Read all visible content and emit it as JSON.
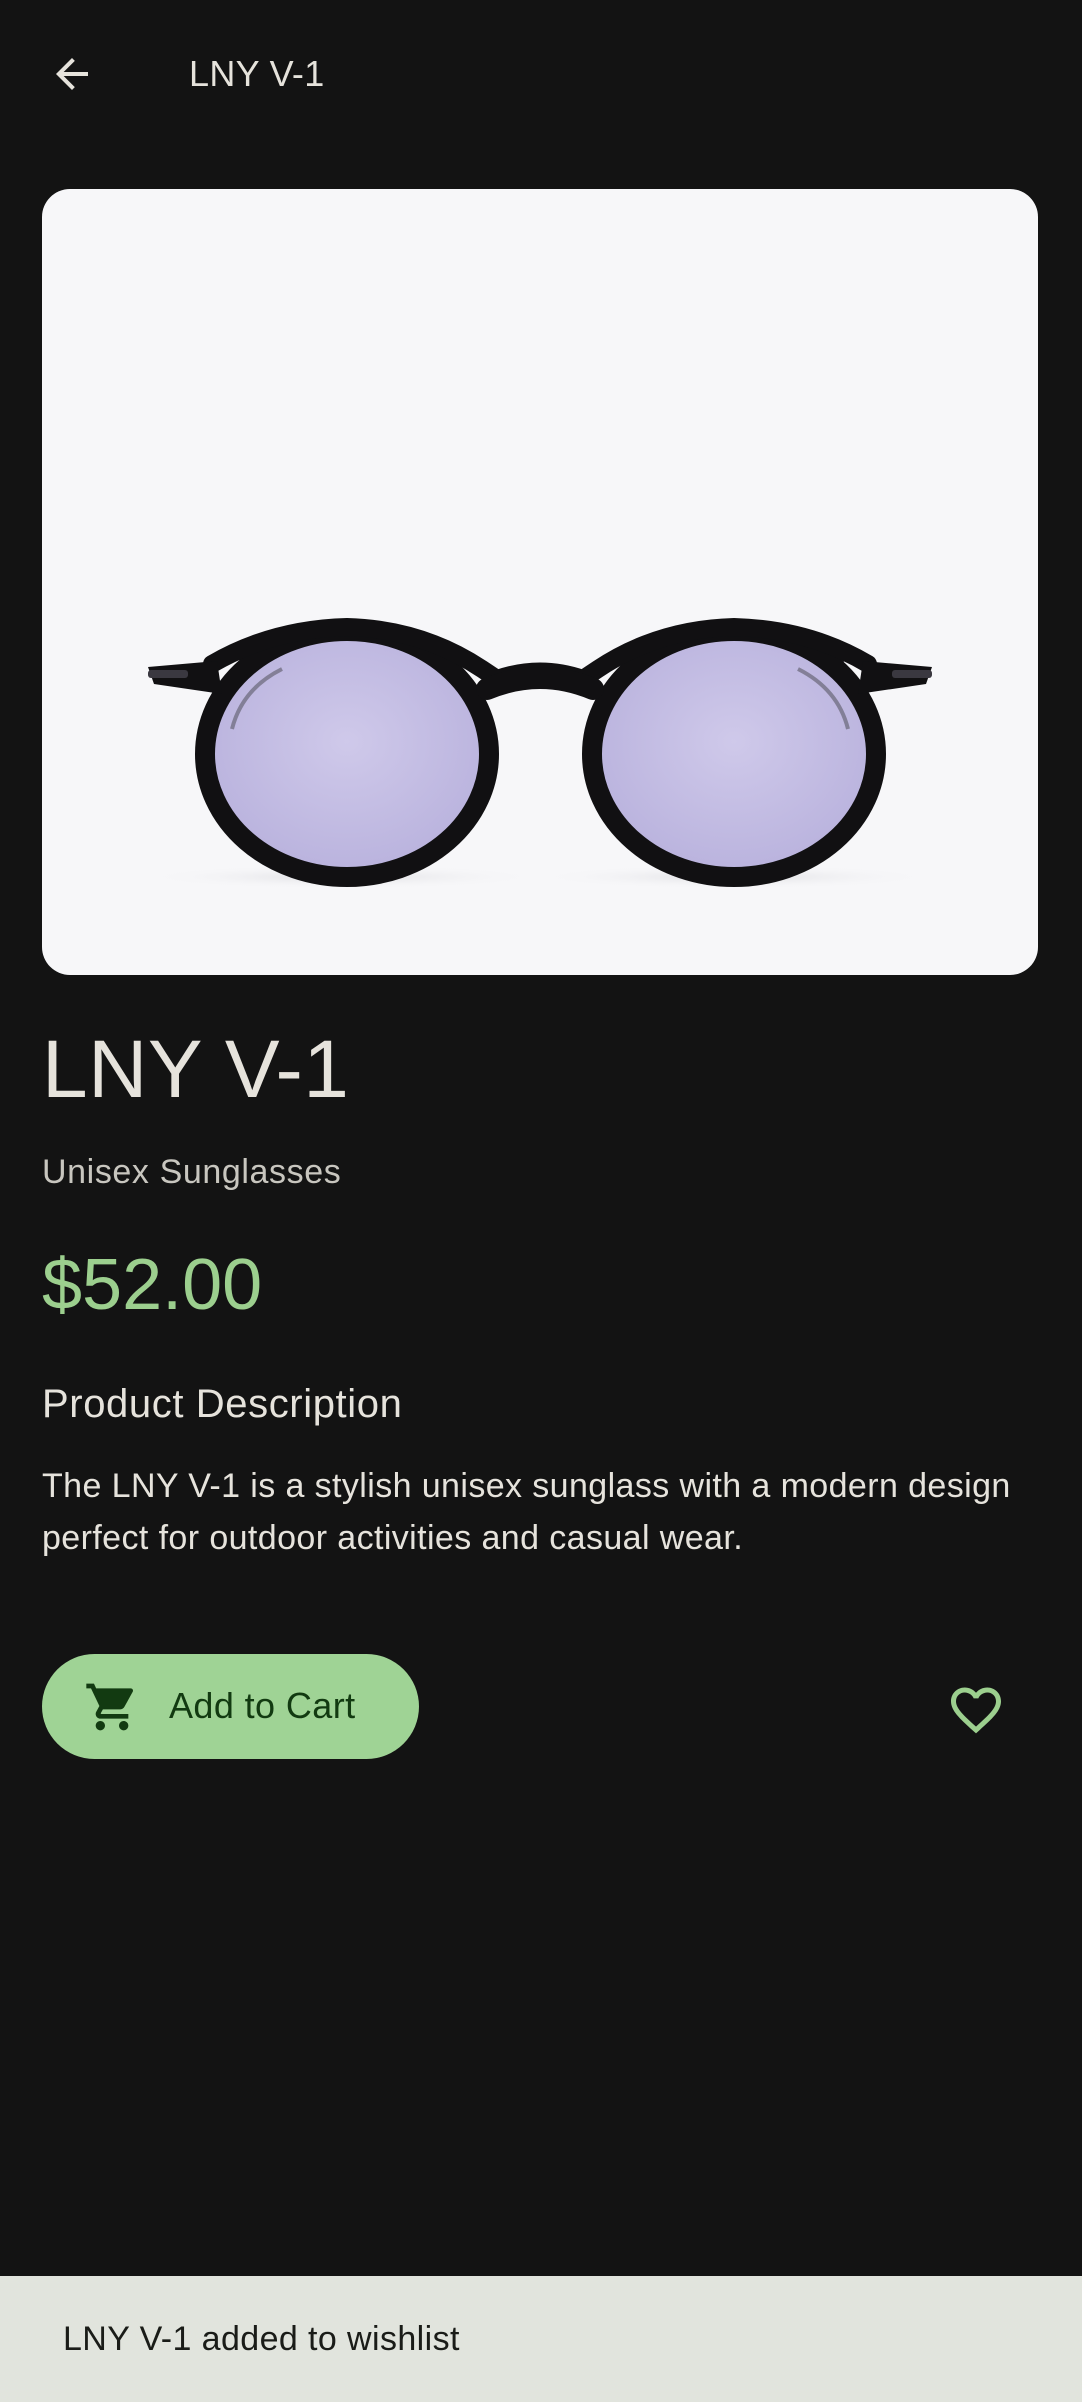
{
  "appbar": {
    "title": "LNY V-1",
    "back_icon": "arrow-back-icon"
  },
  "product": {
    "image_description_icon": "sunglasses-image",
    "title": "LNY V-1",
    "subtitle": "Unisex Sunglasses",
    "price": "$52.00",
    "description_heading": "Product Description",
    "description": "The LNY V-1 is a stylish unisex sunglass with a modern design perfect for outdoor activities and casual wear."
  },
  "actions": {
    "add_to_cart_label": "Add to Cart",
    "cart_icon": "shopping-cart-icon",
    "wishlist_icon": "heart-outline-icon"
  },
  "snackbar": {
    "message": "LNY V-1 added to wishlist"
  },
  "colors": {
    "background": "#131313",
    "accent": "#9fd395",
    "price": "#9ccf8e",
    "snackbar_bg": "#e1e4dd",
    "image_bg": "#f7f7f9"
  }
}
